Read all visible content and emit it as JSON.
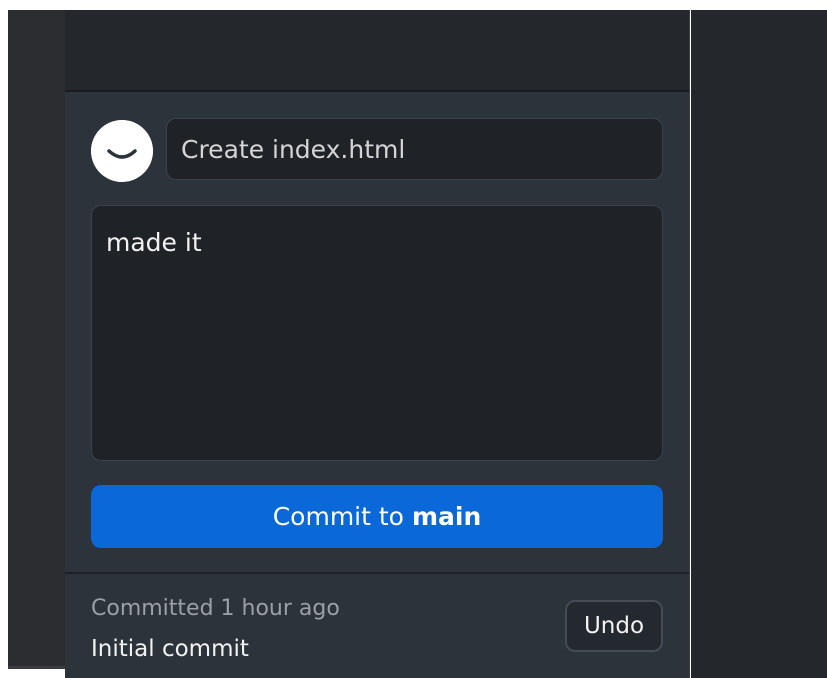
{
  "commit": {
    "summary_value": "",
    "summary_placeholder": "Create index.html",
    "description_value": "made it",
    "button_prefix": "Commit to",
    "branch": "main"
  },
  "history": {
    "time": "Committed 1 hour ago",
    "message": "Initial commit",
    "undo_label": "Undo"
  },
  "avatar": {
    "icon": "smile-avatar-icon"
  },
  "colors": {
    "accent": "#0a68d8",
    "panel_bg": "#2d333b",
    "input_bg": "#1f2328"
  }
}
